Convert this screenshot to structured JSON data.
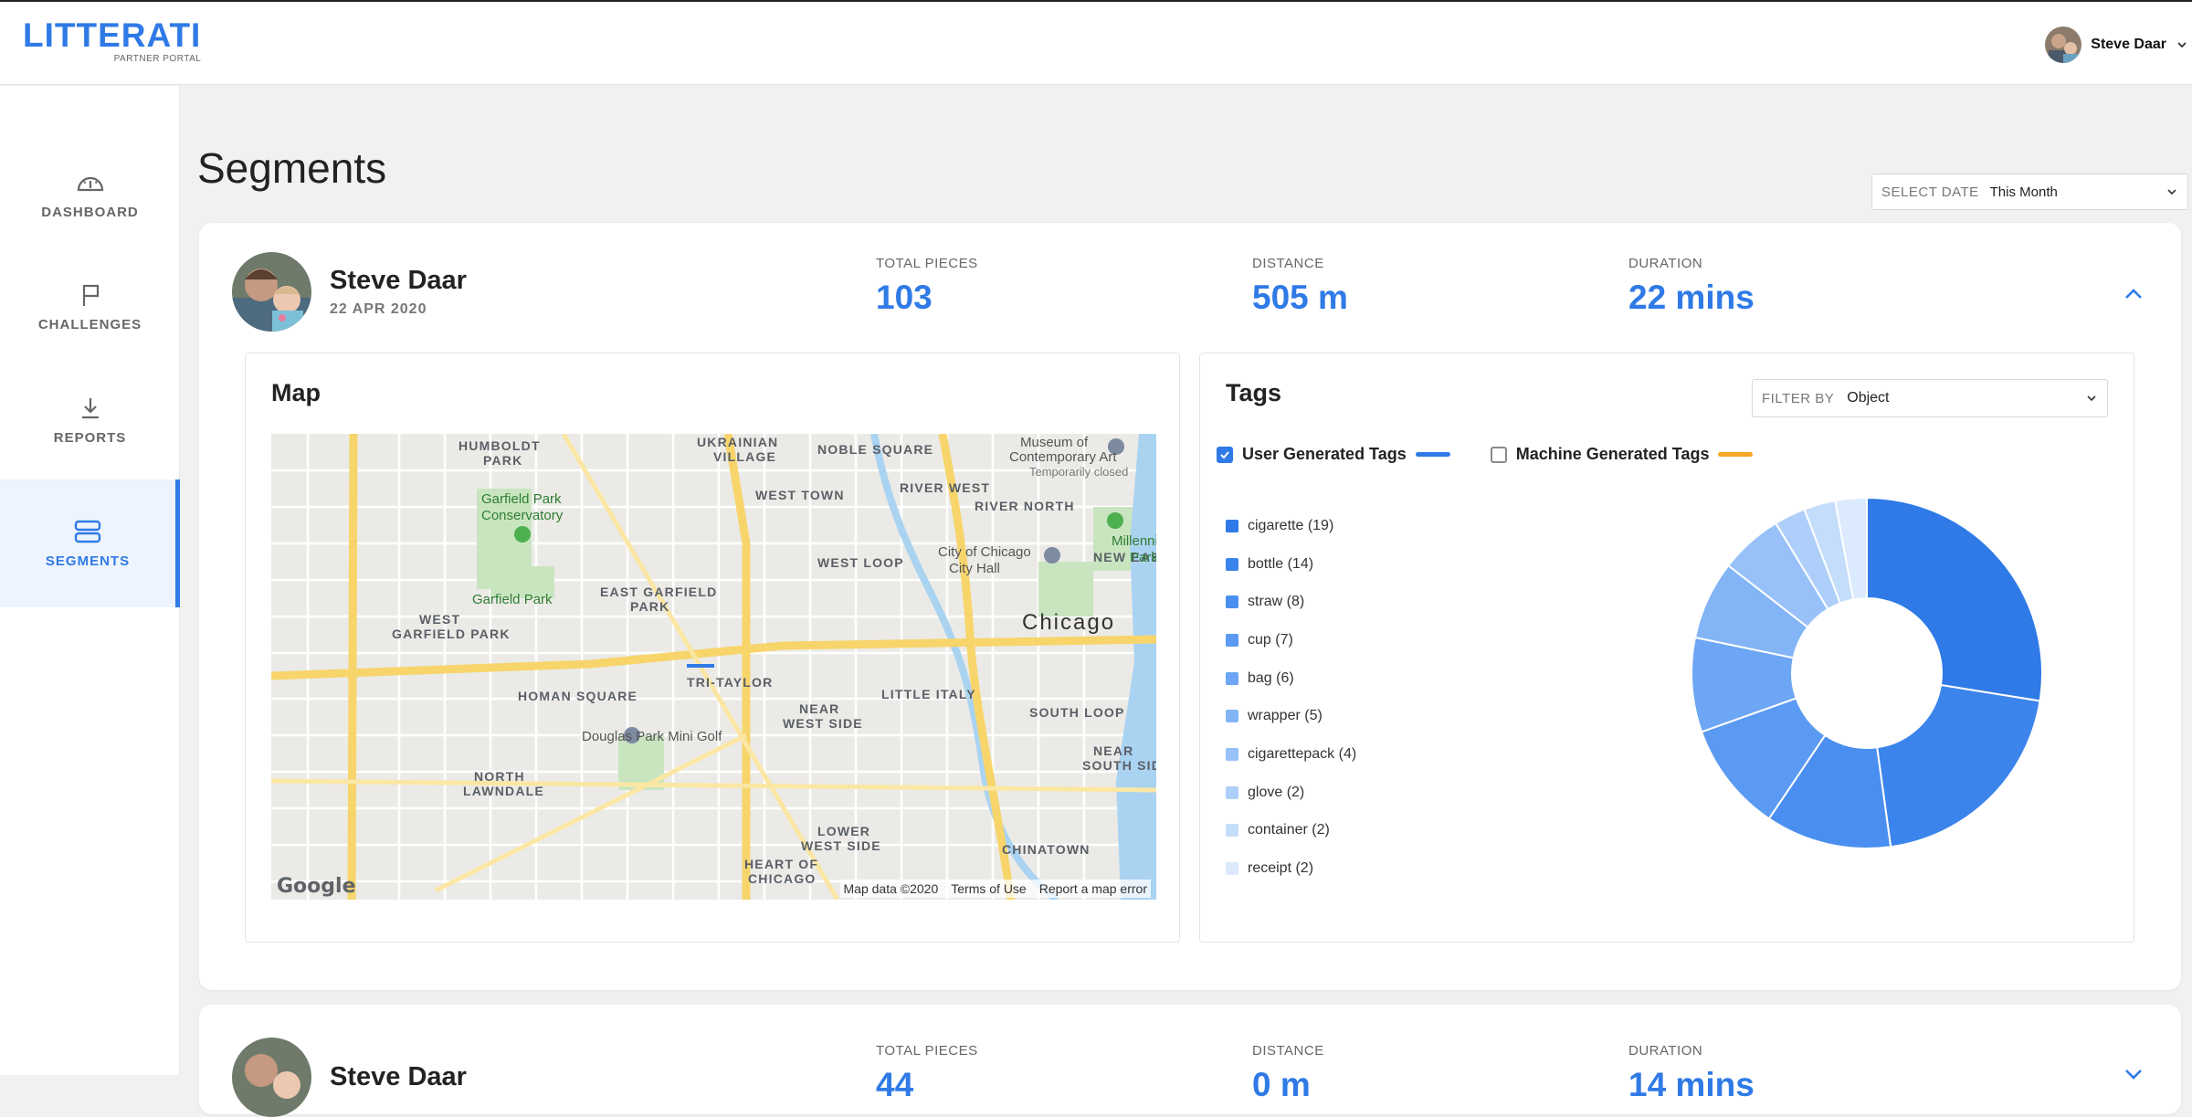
{
  "header": {
    "logo_text": "LITTERATI",
    "logo_subtitle": "PARTNER PORTAL",
    "user_name": "Steve Daar"
  },
  "sidebar": {
    "items": [
      {
        "label": "DASHBOARD",
        "icon": "gauge-icon",
        "active": false
      },
      {
        "label": "CHALLENGES",
        "icon": "flag-icon",
        "active": false
      },
      {
        "label": "REPORTS",
        "icon": "download-icon",
        "active": false
      },
      {
        "label": "SEGMENTS",
        "icon": "segments-icon",
        "active": true
      }
    ]
  },
  "page": {
    "title": "Segments",
    "date_select_label": "SELECT DATE",
    "date_select_value": "This Month"
  },
  "segments": [
    {
      "name": "Steve Daar",
      "date": "22 APR 2020",
      "stats": [
        {
          "label": "TOTAL PIECES",
          "value": "103"
        },
        {
          "label": "DISTANCE",
          "value": "505 m"
        },
        {
          "label": "DURATION",
          "value": "22 mins"
        }
      ],
      "map": {
        "title": "Map",
        "labels": [
          "HUMBOLDT PARK",
          "UKRAINIAN VILLAGE",
          "NOBLE SQUARE",
          "WEST TOWN",
          "RIVER WEST",
          "RIVER NORTH",
          "Garfield Park Conservatory",
          "City of Chicago City Hall",
          "WEST LOOP",
          "Millennium Park",
          "Garfield Park",
          "EAST GARFIELD PARK",
          "WEST GARFIELD PARK",
          "Chicago",
          "NEW EAST",
          "TRI-TAYLOR",
          "HOMAN SQUARE",
          "LITTLE ITALY",
          "SOUTH LOOP",
          "Douglas Park Mini Golf",
          "NEAR WEST SIDE",
          "NORTH LAWNDALE",
          "NEAR SOUTH SIDE",
          "LOWER WEST SIDE",
          "CHINATOWN",
          "HEART OF CHICAGO",
          "Museum of Contemporary Art",
          "Temporarily closed"
        ],
        "attribution": [
          "Map data ©2020",
          "Terms of Use",
          "Report a map error"
        ],
        "google_logo": "Google"
      },
      "tags": {
        "title": "Tags",
        "filter_label": "FILTER BY",
        "filter_value": "Object",
        "toggles": [
          {
            "label": "User Generated Tags",
            "checked": true,
            "color": "#2f7ae6"
          },
          {
            "label": "Machine Generated Tags",
            "checked": false,
            "color": "#f5a623"
          }
        ],
        "items": [
          {
            "label": "cigarette (19)",
            "count": 19,
            "color": "#2f7ae6"
          },
          {
            "label": "bottle (14)",
            "count": 14,
            "color": "#3b84ec"
          },
          {
            "label": "straw (8)",
            "count": 8,
            "color": "#4a8ff0"
          },
          {
            "label": "cup (7)",
            "count": 7,
            "color": "#5a9af2"
          },
          {
            "label": "bag (6)",
            "count": 6,
            "color": "#6ca6f4"
          },
          {
            "label": "wrapper (5)",
            "count": 5,
            "color": "#82b4f6"
          },
          {
            "label": "cigarettepack (4)",
            "count": 4,
            "color": "#97c1f8"
          },
          {
            "label": "glove (2)",
            "count": 2,
            "color": "#aecffa"
          },
          {
            "label": "container (2)",
            "count": 2,
            "color": "#c4ddfb"
          },
          {
            "label": "receipt (2)",
            "count": 2,
            "color": "#dbeafd"
          }
        ]
      }
    },
    {
      "name": "Steve Daar",
      "stats": [
        {
          "label": "TOTAL PIECES",
          "value": "44"
        },
        {
          "label": "DISTANCE",
          "value": "0 m"
        },
        {
          "label": "DURATION",
          "value": "14 mins"
        }
      ]
    }
  ]
}
